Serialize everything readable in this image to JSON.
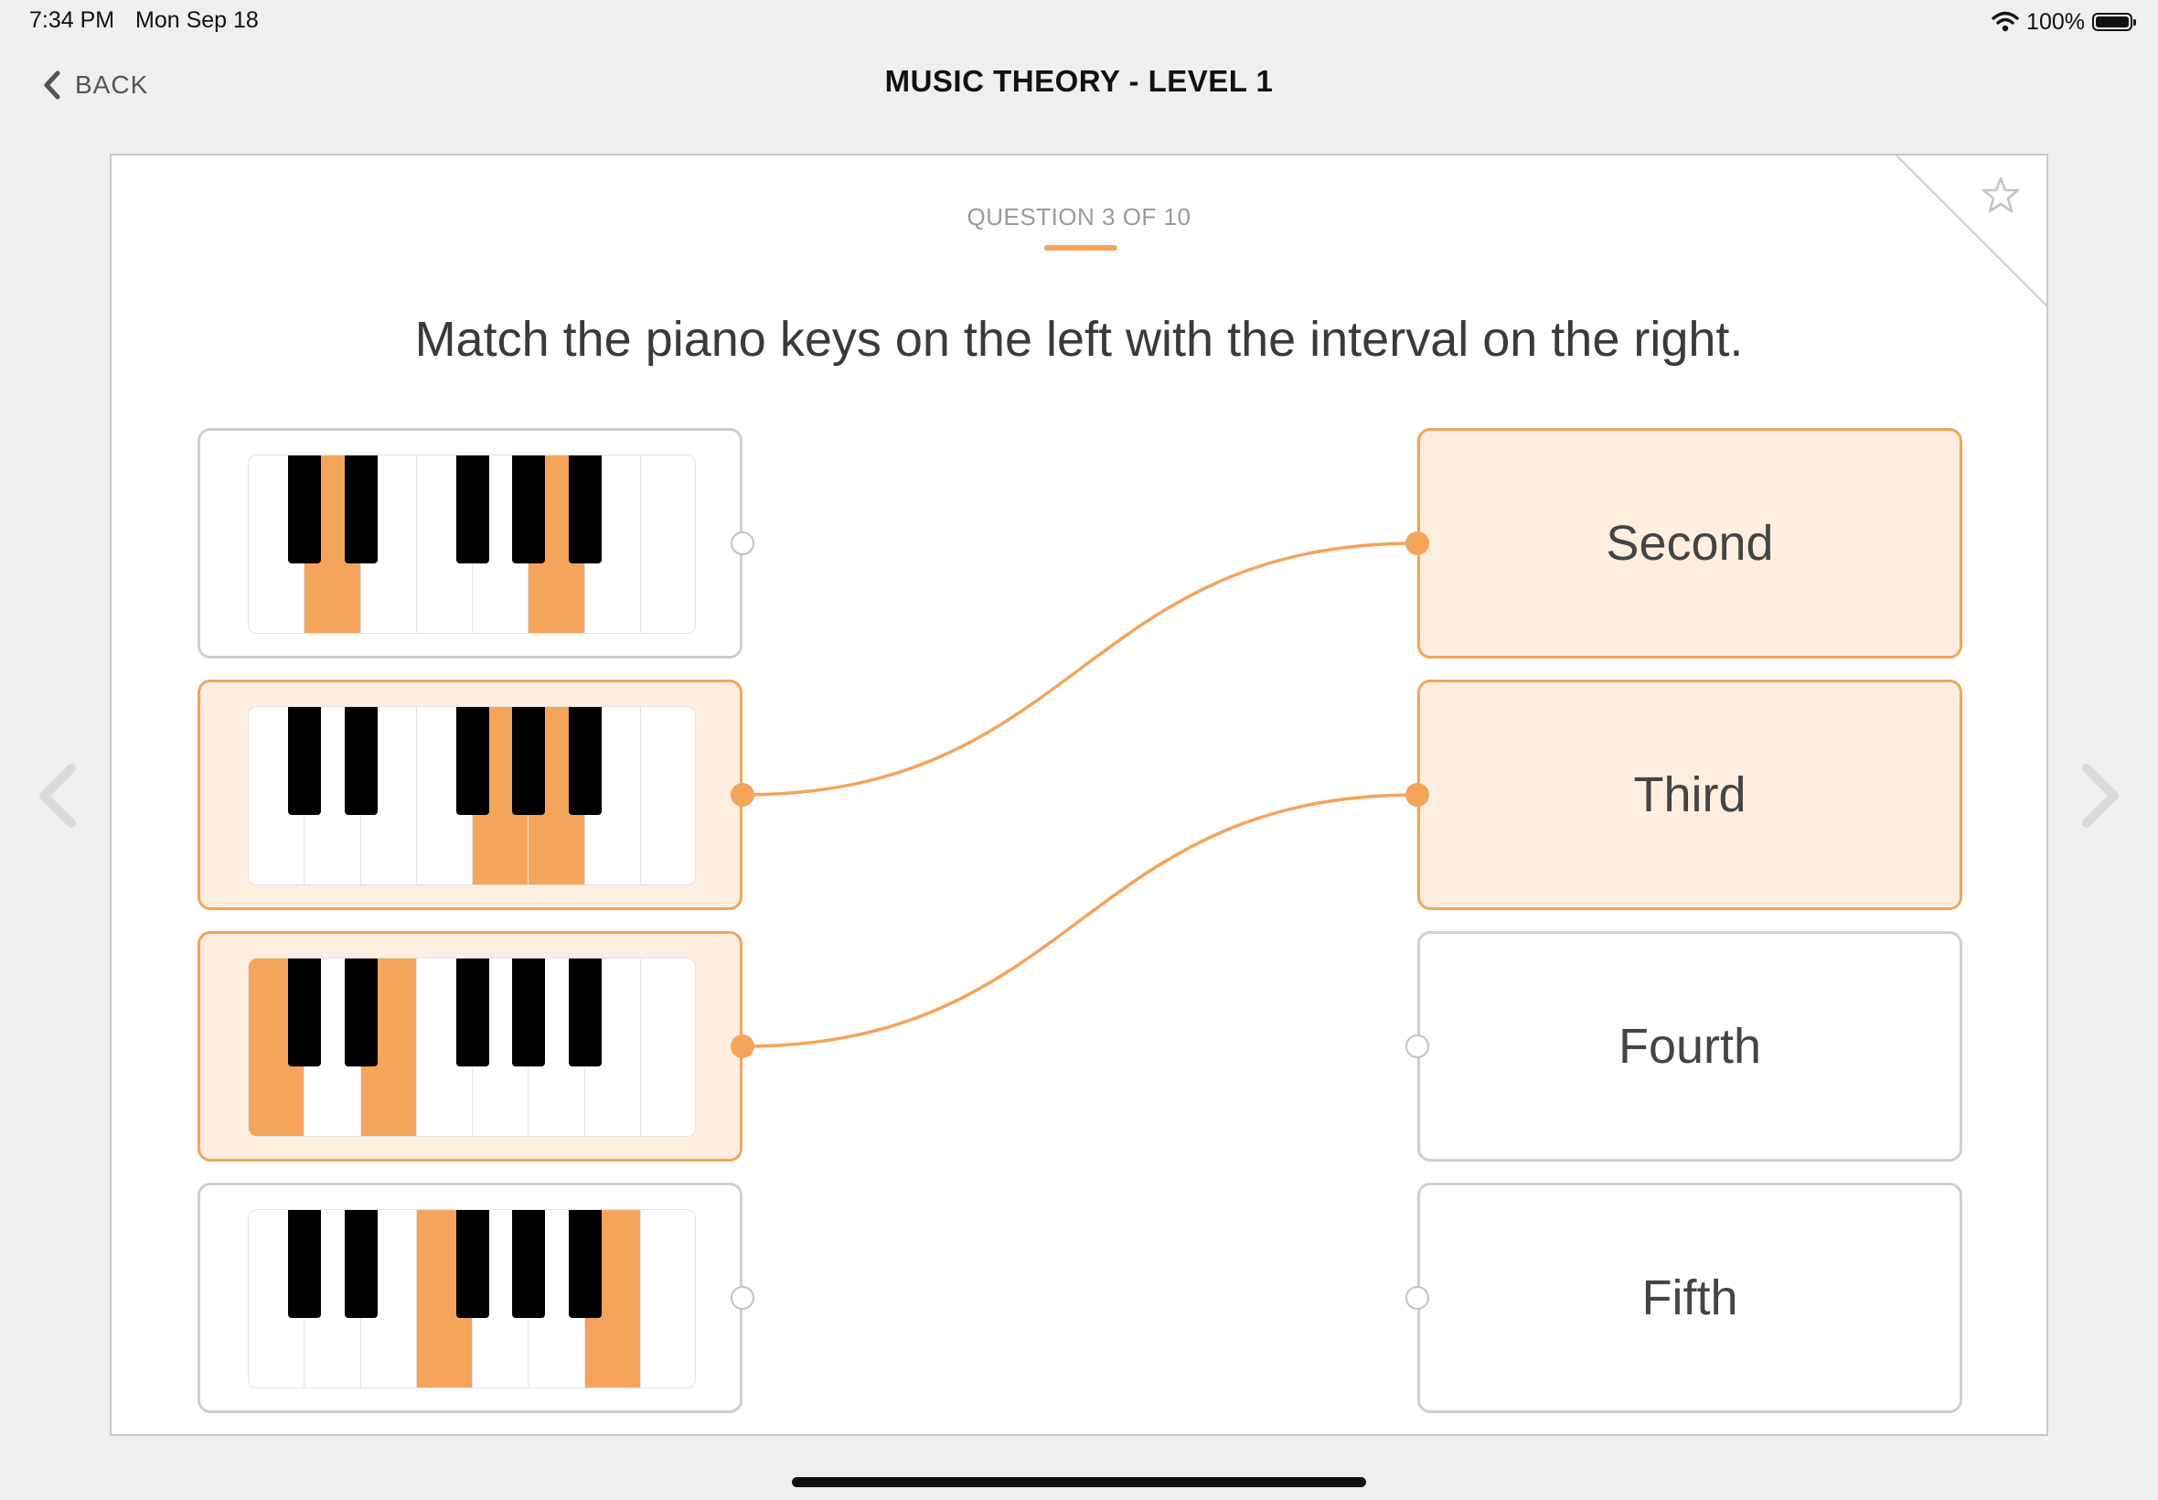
{
  "status_bar": {
    "time": "7:34 PM",
    "date": "Mon Sep 18",
    "battery": "100%",
    "battery_level": 1.0
  },
  "nav": {
    "back_label": "BACK",
    "title": "MUSIC THEORY - LEVEL 1"
  },
  "question": {
    "counter": "QUESTION 3 OF 10",
    "prompt": "Match the piano keys on the left with the interval on the right."
  },
  "colors": {
    "accent": "#f4a45b",
    "accent_light": "#fdeee0",
    "border": "#cfcfcf",
    "background": "#efefef"
  },
  "keyboards": [
    {
      "highlighted_white": [
        1,
        5
      ],
      "highlighted_black": [],
      "selected": false,
      "matched_to": null
    },
    {
      "highlighted_white": [
        4,
        5
      ],
      "highlighted_black": [],
      "selected": true,
      "matched_to": "Second"
    },
    {
      "highlighted_white": [
        0,
        2
      ],
      "highlighted_black": [],
      "selected": true,
      "matched_to": "Third"
    },
    {
      "highlighted_white": [
        3,
        6
      ],
      "highlighted_black": [],
      "selected": false,
      "matched_to": null
    }
  ],
  "intervals": [
    {
      "label": "Second",
      "selected": true
    },
    {
      "label": "Third",
      "selected": true
    },
    {
      "label": "Fourth",
      "selected": false
    },
    {
      "label": "Fifth",
      "selected": false
    }
  ],
  "connections": [
    {
      "from_keyboard": 1,
      "to_interval": 0
    },
    {
      "from_keyboard": 2,
      "to_interval": 1
    }
  ],
  "icons": {
    "back": "chevron-left-icon",
    "favorite": "star-outline-icon",
    "previous": "chevron-left-icon",
    "next": "chevron-right-icon",
    "wifi": "wifi-icon",
    "battery": "battery-icon"
  }
}
